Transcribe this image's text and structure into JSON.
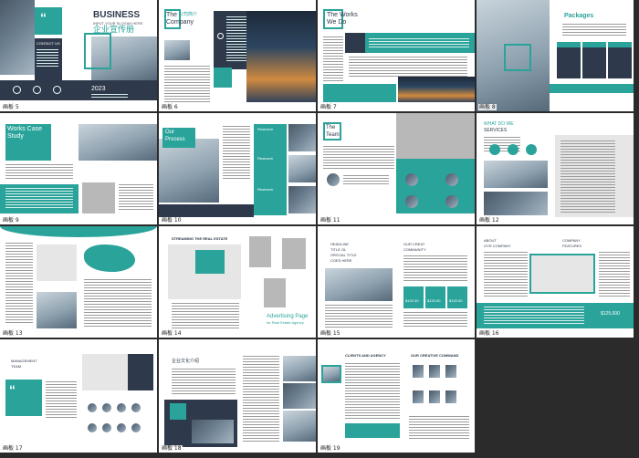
{
  "boards": [
    {
      "label": "画板 5",
      "title": "BUSINESS",
      "slogan": "INPUT YOUR SLOGAN HERE",
      "cn_title": "企业宣传册",
      "contact": "CONTACT US",
      "year": "2023"
    },
    {
      "label": "画板 6",
      "title_line1": "The",
      "title_line2": "Company",
      "tag": "公司简介"
    },
    {
      "label": "画板 7",
      "title_line1": "The Works",
      "title_line2": "We Do"
    },
    {
      "label": "画板 8",
      "title": "Packages"
    },
    {
      "label": "画板 9",
      "title_line1": "Works Case",
      "title_line2": "Study"
    },
    {
      "label": "画板 10",
      "title_line1": "Our",
      "title_line2": "Process",
      "items": [
        "Research",
        "Research",
        "Research"
      ]
    },
    {
      "label": "画板 11",
      "title_line1": "The",
      "title_line2": "Team"
    },
    {
      "label": "画板 12",
      "title_line1": "WHAT DO WE",
      "title_line2": "SERVICES"
    },
    {
      "label": "画板 13"
    },
    {
      "label": "画板 14",
      "title": "STREAMING THE REAL ESTATE",
      "ad_line1": "Advertising Page",
      "ad_line2": "for Real Estate Agency"
    },
    {
      "label": "画板 15",
      "headline": [
        "HEADLINE",
        "TITLE OL",
        "SPECIAL TITLE",
        "COES HERE"
      ],
      "community": [
        "OUR CREAT",
        "COMMUNITY"
      ],
      "prices": [
        "$120.00",
        "$120.00",
        "$120.00"
      ]
    },
    {
      "label": "画板 16",
      "about": [
        "ABOUT",
        "OYR COMPANY"
      ],
      "features": [
        "COMPANY",
        "FEATURES"
      ],
      "price": "$125.000"
    },
    {
      "label": "画板 17",
      "team": [
        "MANAGEMENT",
        "TEAM"
      ]
    },
    {
      "label": "画板 18",
      "tag": "企业文化介绍"
    },
    {
      "label": "画板 19",
      "clients": "CLIENTS AND AGENCY",
      "creative": "OUR CREATIVE COMMAND"
    }
  ],
  "colors": {
    "accent": "#2aa39a",
    "accent_dark": "#1f8c84",
    "navy": "#2e3a4b",
    "background": "#2b2b2b"
  }
}
